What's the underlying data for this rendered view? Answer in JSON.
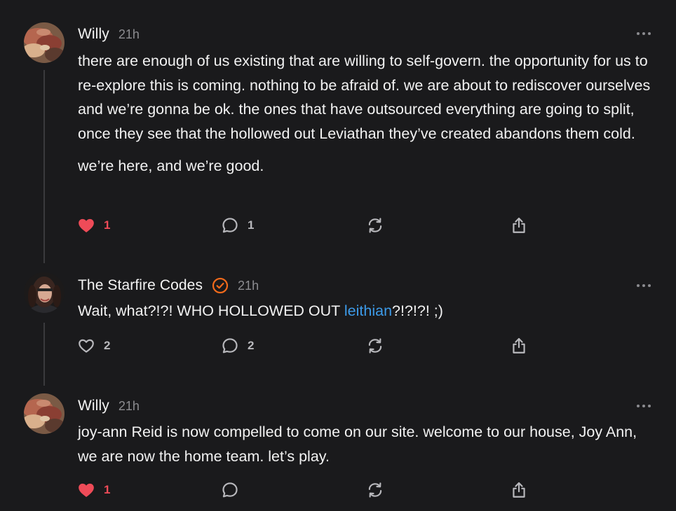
{
  "colors": {
    "background": "#1a1a1c",
    "text": "#f2f2f2",
    "muted": "#8c8c90",
    "link": "#3d9be9",
    "liked": "#ef4b58",
    "verified": "#f26a1b"
  },
  "posts": [
    {
      "author": "Willy",
      "time": "21h",
      "verified": false,
      "paragraphs": [
        "there are enough of us existing that are willing to self-govern. the opportunity for us to re-explore this is coming. nothing to be afraid of. we are about to rediscover ourselves and we’re gonna be ok. the ones that have outsourced everything are going to split, once they see that the hollowed out Leviathan they’ve created abandons them cold.",
        "we’re here, and we’re good."
      ],
      "likes": "1",
      "liked": true,
      "replies": "1",
      "icons": [
        "heart-filled-icon",
        "comment-icon",
        "restack-icon",
        "share-icon",
        "more-icon"
      ]
    },
    {
      "author": "The Starfire Codes",
      "time": "21h",
      "verified": true,
      "text_before": "Wait, what?!?! WHO HOLLOWED OUT ",
      "link_text": "leithian",
      "text_after": "?!?!?! ;)",
      "likes": "2",
      "liked": false,
      "replies": "2",
      "icons": [
        "heart-outline-icon",
        "comment-icon",
        "restack-icon",
        "share-icon",
        "more-icon",
        "verified-check-icon"
      ]
    },
    {
      "author": "Willy",
      "time": "21h",
      "verified": false,
      "paragraphs": [
        "joy-ann Reid is now compelled to come on our site. welcome to our house, Joy Ann, we are now the home team. let’s play."
      ],
      "likes": "1",
      "liked": true,
      "replies": "",
      "icons": [
        "heart-filled-icon",
        "comment-icon",
        "restack-icon",
        "share-icon",
        "more-icon"
      ]
    }
  ]
}
